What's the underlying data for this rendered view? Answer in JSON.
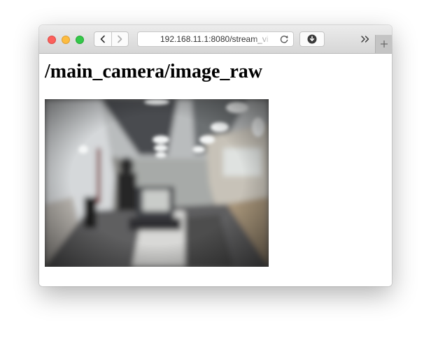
{
  "browser": {
    "url": "192.168.11.1:8080/stream_vi",
    "icons": {
      "back": "chevron-left-icon",
      "forward": "chevron-right-icon",
      "reload": "reload-icon",
      "download": "download-icon",
      "overflow": "double-chevron-right-icon",
      "new_tab": "plus-icon"
    },
    "colors": {
      "close": "#fc605c",
      "minimize": "#fdbc40",
      "zoom": "#34c84a"
    }
  },
  "page": {
    "title": "/main_camera/image_raw",
    "image_description": "blurry fisheye camera view of an office"
  }
}
